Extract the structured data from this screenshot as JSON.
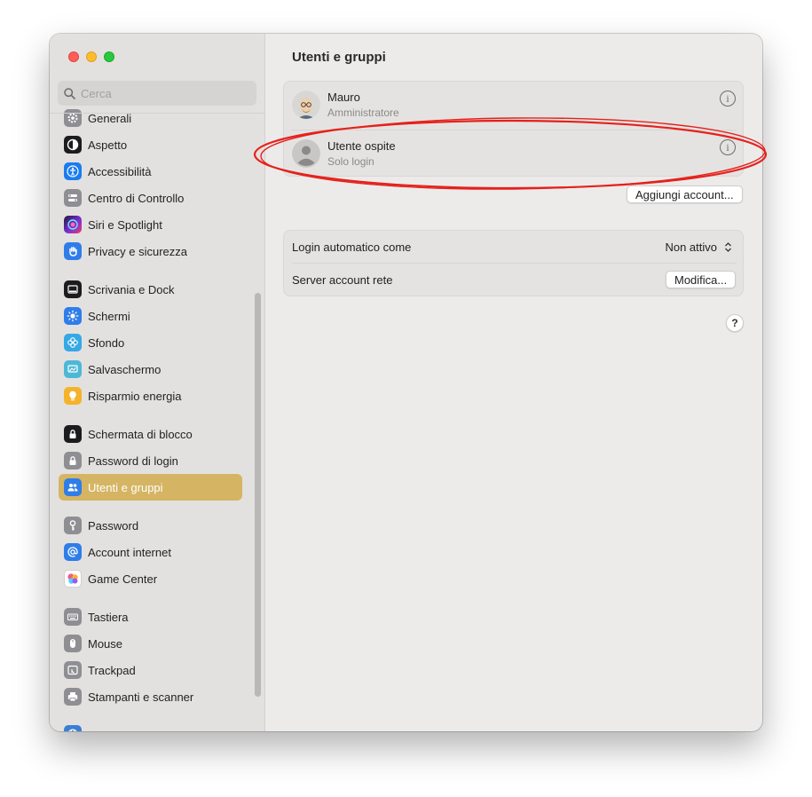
{
  "search": {
    "placeholder": "Cerca"
  },
  "sidebar": {
    "items": [
      {
        "label": "Generali",
        "icon": "gear-icon",
        "color": "#8e8e93"
      },
      {
        "label": "Aspetto",
        "icon": "appearance-icon",
        "color": "#1c1c1e"
      },
      {
        "label": "Accessibilità",
        "icon": "accessibility-icon",
        "color": "#1a7cf0"
      },
      {
        "label": "Centro di Controllo",
        "icon": "control-center-icon",
        "color": "#8e8e93"
      },
      {
        "label": "Siri e Spotlight",
        "icon": "siri-icon",
        "color": "#6a3bd8"
      },
      {
        "label": "Privacy e sicurezza",
        "icon": "hand-icon",
        "color": "#2f7de9"
      },
      {
        "label": "Scrivania e Dock",
        "icon": "dock-icon",
        "color": "#1c1c1e"
      },
      {
        "label": "Schermi",
        "icon": "sun-icon",
        "color": "#2f7de9"
      },
      {
        "label": "Sfondo",
        "icon": "flower-icon",
        "color": "#35a8e6"
      },
      {
        "label": "Salvaschermo",
        "icon": "screensaver-icon",
        "color": "#4cb8d6"
      },
      {
        "label": "Risparmio energia",
        "icon": "lightbulb-icon",
        "color": "#f5b32b"
      },
      {
        "label": "Schermata di blocco",
        "icon": "lock-icon",
        "color": "#1c1c1e"
      },
      {
        "label": "Password di login",
        "icon": "lock-icon",
        "color": "#8e8e93"
      },
      {
        "label": "Utenti e gruppi",
        "icon": "users-icon",
        "color": "#2f7de9"
      },
      {
        "label": "Password",
        "icon": "key-icon",
        "color": "#8e8e93"
      },
      {
        "label": "Account internet",
        "icon": "at-icon",
        "color": "#2f7de9"
      },
      {
        "label": "Game Center",
        "icon": "game-center-icon",
        "color": "#ffffff"
      },
      {
        "label": "Tastiera",
        "icon": "keyboard-icon",
        "color": "#8e8e93"
      },
      {
        "label": "Mouse",
        "icon": "mouse-icon",
        "color": "#8e8e93"
      },
      {
        "label": "Trackpad",
        "icon": "trackpad-icon",
        "color": "#8e8e93"
      },
      {
        "label": "Stampanti e scanner",
        "icon": "printer-icon",
        "color": "#8e8e93"
      }
    ],
    "active": "Utenti e gruppi"
  },
  "main": {
    "title": "Utenti e gruppi",
    "users": [
      {
        "name": "Mauro",
        "role": "Amministratore",
        "avatar": "memoji-avatar-icon"
      },
      {
        "name": "Utente ospite",
        "role": "Solo login",
        "avatar": "guest-avatar-icon"
      }
    ],
    "add_account_label": "Aggiungi account...",
    "settings": {
      "auto_login_label": "Login automatico come",
      "auto_login_value": "Non attivo",
      "network_server_label": "Server account rete",
      "edit_label": "Modifica..."
    },
    "help_label": "?",
    "info_glyph": "i"
  },
  "colors": {
    "accent": "#d5b463",
    "annotation": "#e5211c"
  }
}
